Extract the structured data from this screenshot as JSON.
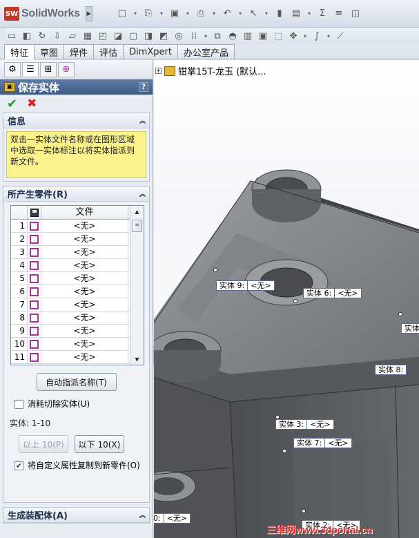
{
  "app": {
    "name": "SolidWorks",
    "logo_mark": "SW"
  },
  "toolbar_icons_top": [
    "new-doc-icon",
    "open-icon",
    "save-icon",
    "print-icon",
    "undo-icon",
    "select-icon",
    "rebuild-icon",
    "options-icon",
    "sum-icon",
    "equation-icon",
    "view-icon"
  ],
  "command_tabs": [
    "特征",
    "草图",
    "焊件",
    "评估",
    "DimXpert",
    "办公室产品"
  ],
  "active_tab_index": 0,
  "panel": {
    "title": "保存实体",
    "help": "?",
    "info_header": "信息",
    "info_text": "双击一实体文件名称或在图形区域中选取一实体标注以将实体指派到新文件。",
    "parts_header": "所产生零件(R)",
    "table": {
      "header_file": "文件",
      "rows": [
        {
          "n": "1",
          "file": "<无>"
        },
        {
          "n": "2",
          "file": "<无>"
        },
        {
          "n": "3",
          "file": "<无>"
        },
        {
          "n": "4",
          "file": "<无>"
        },
        {
          "n": "5",
          "file": "<无>"
        },
        {
          "n": "6",
          "file": "<无>"
        },
        {
          "n": "7",
          "file": "<无>"
        },
        {
          "n": "8",
          "file": "<无>"
        },
        {
          "n": "9",
          "file": "<无>"
        },
        {
          "n": "10",
          "file": "<无>"
        },
        {
          "n": "11",
          "file": "<无>"
        }
      ]
    },
    "auto_assign_button": "自动指派名称(T)",
    "consume_cut_label": "消耗切除实体(U)",
    "consume_cut_checked": false,
    "bodies_range": "实体: 1-10",
    "prev_button": "以上 10(P)",
    "next_button": "以下 10(X)",
    "copy_props_label": "将自定义属性复制到新零件(O)",
    "copy_props_checked": true,
    "assembly_header": "生成装配体(A)"
  },
  "tree": {
    "label": "钳掌15T-龙玉 (默认..."
  },
  "body_tags": [
    {
      "id": "t1",
      "name": "实体  9:",
      "file": "<无>"
    },
    {
      "id": "t2",
      "name": "实体  6:",
      "file": "<无>"
    },
    {
      "id": "t3",
      "name": "实体",
      "file": ""
    },
    {
      "id": "t4",
      "name": "实体  8:",
      "file": ""
    },
    {
      "id": "t5",
      "name": "实体  3:",
      "file": "<无>"
    },
    {
      "id": "t6",
      "name": "实体  7:",
      "file": "<无>"
    },
    {
      "id": "t7",
      "name": "0:",
      "file": "<无>"
    },
    {
      "id": "t8",
      "name": "实体  2:",
      "file": "<无>"
    }
  ],
  "watermark": "三维网www.3dportal.cn"
}
